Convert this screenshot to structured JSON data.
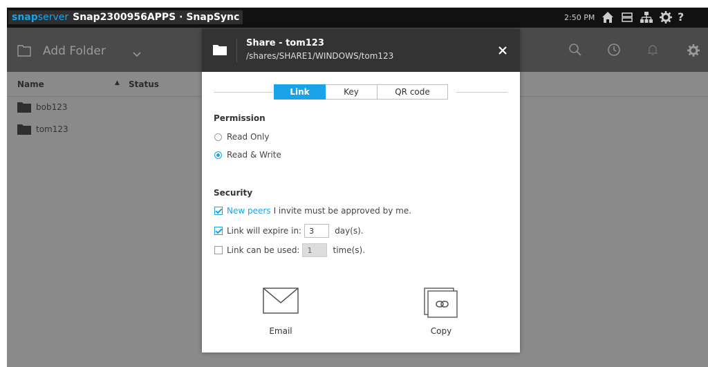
{
  "topbar": {
    "brand_snap": "snap",
    "brand_server": "server",
    "server_name": "Snap2300956APPS · SnapSync",
    "time": "2:50 PM",
    "icons": [
      "home-icon",
      "storage-icon",
      "network-icon",
      "gear-icon",
      "help-icon"
    ]
  },
  "toolbar": {
    "add_folder_label": "Add Folder",
    "icons": [
      "search-icon",
      "clock-icon",
      "bell-icon",
      "gear-icon"
    ]
  },
  "list": {
    "columns": {
      "name": "Name",
      "status": "Status"
    },
    "rows": [
      {
        "name": "bob123"
      },
      {
        "name": "tom123"
      }
    ]
  },
  "dialog": {
    "title": "Share - tom123",
    "path": "/shares/SHARE1/WINDOWS/tom123",
    "tabs": [
      "Link",
      "Key",
      "QR code"
    ],
    "active_tab": "Link",
    "permission": {
      "label": "Permission",
      "options": [
        "Read Only",
        "Read & Write"
      ],
      "selected": "Read & Write"
    },
    "security": {
      "label": "Security",
      "new_peers_link": "New peers",
      "new_peers_text": "I invite must be approved by me.",
      "new_peers_checked": true,
      "expire_label": "Link will expire in:",
      "expire_value": "3",
      "expire_unit": "day(s).",
      "expire_checked": true,
      "used_label": "Link can be used:",
      "used_value": "1",
      "used_unit": "time(s).",
      "used_checked": false
    },
    "actions": {
      "email": "Email",
      "copy": "Copy"
    }
  },
  "colors": {
    "accent": "#1aa3e8",
    "header_bg": "#333333",
    "topbar_bg": "#111111",
    "overlay_bg": "#8a8a8a"
  }
}
